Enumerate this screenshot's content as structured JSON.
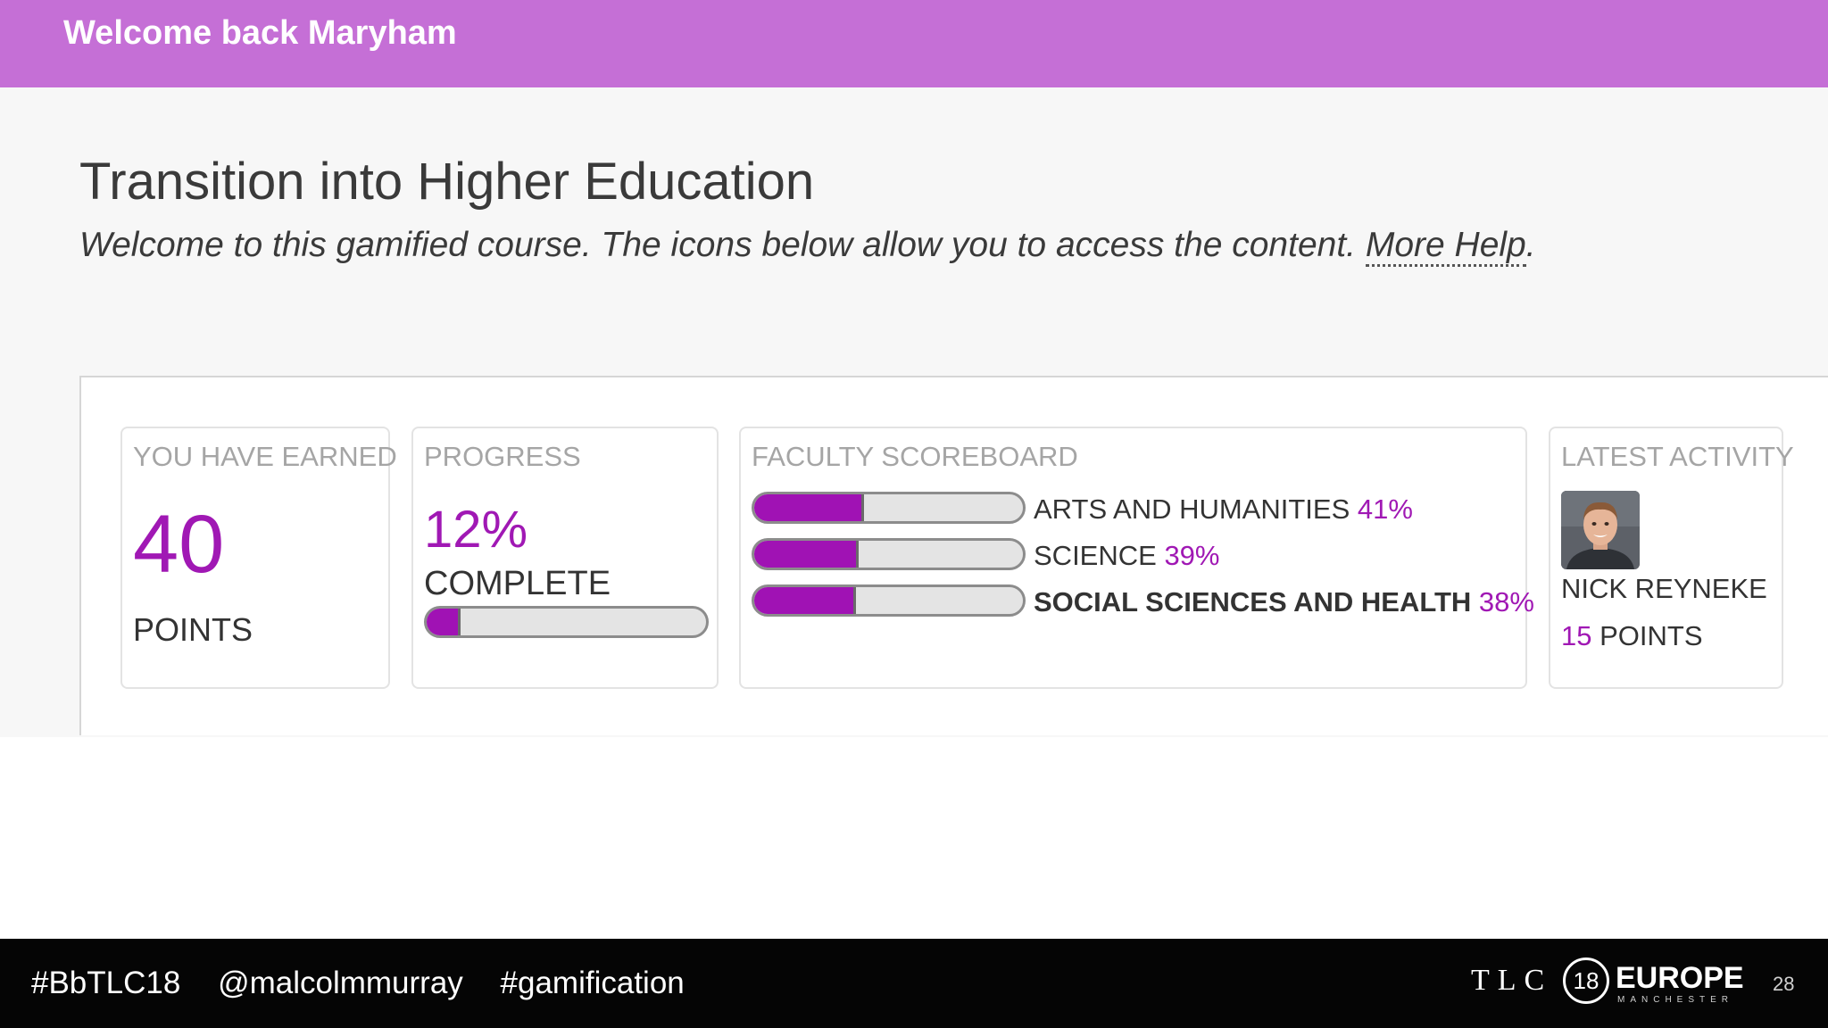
{
  "header": {
    "greeting": "Welcome back Maryham",
    "bg_color": "#c56fd6"
  },
  "course": {
    "title": "Transition into Higher Education",
    "subtitle": "Welcome to this gamified course. The icons below allow you to access the content.",
    "help_link": "More Help",
    "help_suffix": "."
  },
  "earned": {
    "title": "YOU HAVE EARNED",
    "points": "40",
    "points_label": "POINTS"
  },
  "progress": {
    "title": "PROGRESS",
    "percent_text": "12%",
    "complete_label": "COMPLETE",
    "fraction": 0.12
  },
  "scoreboard": {
    "title": "FACULTY SCOREBOARD",
    "rows": [
      {
        "name": "ARTS AND HUMANITIES",
        "value": "41%",
        "fraction": 0.41,
        "bold": false
      },
      {
        "name": "SCIENCE",
        "value": "39%",
        "fraction": 0.39,
        "bold": false
      },
      {
        "name": "SOCIAL SCIENCES AND HEALTH",
        "value": "38%",
        "fraction": 0.38,
        "bold": true
      }
    ]
  },
  "activity": {
    "title": "LATEST ACTIVITY",
    "avatar_icon": "user-avatar-photo",
    "name": "NICK REYNEKE",
    "points_num": "15",
    "points_label": "POINTS"
  },
  "footer": {
    "tags": [
      "#BbTLC18",
      "@malcolmmurray",
      "#gamification"
    ],
    "logo_letters": "TLC",
    "logo_number": "18",
    "logo_word": "EUROPE",
    "logo_city": "MANCHESTER",
    "slide_number": "28"
  },
  "colors": {
    "accent": "#a018b4",
    "bar_fill": "#a012b4",
    "bar_track": "#e4e4e4"
  }
}
